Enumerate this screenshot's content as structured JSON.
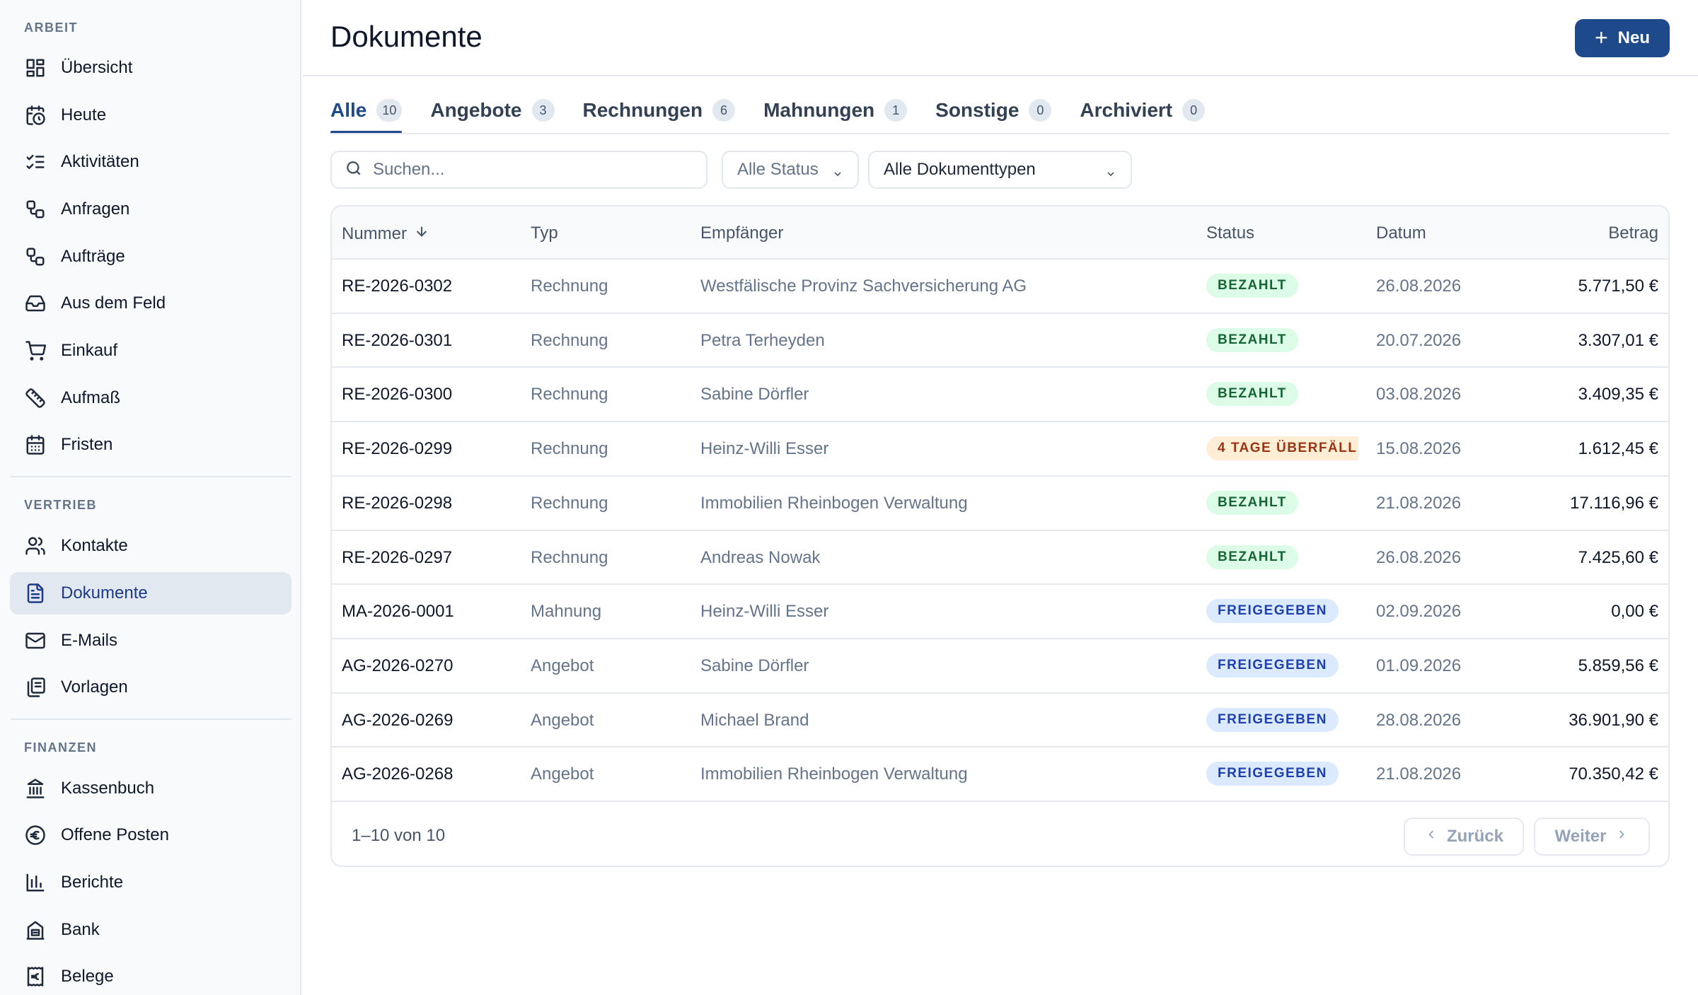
{
  "sidebar": {
    "sections": [
      {
        "title": "ARBEIT",
        "items": [
          {
            "label": "Übersicht",
            "icon": "dashboard-icon"
          },
          {
            "label": "Heute",
            "icon": "calendar-clock-icon"
          },
          {
            "label": "Aktivitäten",
            "icon": "list-checks-icon"
          },
          {
            "label": "Anfragen",
            "icon": "workflow-icon"
          },
          {
            "label": "Aufträge",
            "icon": "workflow-icon"
          },
          {
            "label": "Aus dem Feld",
            "icon": "inbox-icon"
          },
          {
            "label": "Einkauf",
            "icon": "cart-icon"
          },
          {
            "label": "Aufmaß",
            "icon": "ruler-icon"
          },
          {
            "label": "Fristen",
            "icon": "calendar-icon"
          }
        ]
      },
      {
        "title": "VERTRIEB",
        "items": [
          {
            "label": "Kontakte",
            "icon": "users-icon"
          },
          {
            "label": "Dokumente",
            "icon": "document-icon",
            "active": true
          },
          {
            "label": "E-Mails",
            "icon": "mail-icon"
          },
          {
            "label": "Vorlagen",
            "icon": "copy-icon"
          }
        ]
      },
      {
        "title": "FINANZEN",
        "items": [
          {
            "label": "Kassenbuch",
            "icon": "bank-icon"
          },
          {
            "label": "Offene Posten",
            "icon": "euro-circle-icon"
          },
          {
            "label": "Berichte",
            "icon": "bar-chart-icon"
          },
          {
            "label": "Bank",
            "icon": "building-icon"
          },
          {
            "label": "Belege",
            "icon": "receipt-euro-icon"
          }
        ]
      }
    ]
  },
  "header": {
    "title": "Dokumente",
    "new_button": "Neu"
  },
  "tabs": [
    {
      "label": "Alle",
      "count": "10",
      "active": true
    },
    {
      "label": "Angebote",
      "count": "3"
    },
    {
      "label": "Rechnungen",
      "count": "6"
    },
    {
      "label": "Mahnungen",
      "count": "1"
    },
    {
      "label": "Sonstige",
      "count": "0"
    },
    {
      "label": "Archiviert",
      "count": "0"
    }
  ],
  "filters": {
    "search_placeholder": "Suchen...",
    "status_select": "Alle Status",
    "type_select": "Alle Dokumenttypen"
  },
  "table": {
    "columns": {
      "number": "Nummer",
      "type": "Typ",
      "recipient": "Empfänger",
      "status": "Status",
      "date": "Datum",
      "amount": "Betrag"
    },
    "rows": [
      {
        "number": "RE-2026-0302",
        "type": "Rechnung",
        "recipient": "Westfälische Provinz Sachversicherung AG",
        "status": "BEZAHLT",
        "status_kind": "paid",
        "date": "26.08.2026",
        "amount": "5.771,50 €"
      },
      {
        "number": "RE-2026-0301",
        "type": "Rechnung",
        "recipient": "Petra Terheyden",
        "status": "BEZAHLT",
        "status_kind": "paid",
        "date": "20.07.2026",
        "amount": "3.307,01 €"
      },
      {
        "number": "RE-2026-0300",
        "type": "Rechnung",
        "recipient": "Sabine Dörfler",
        "status": "BEZAHLT",
        "status_kind": "paid",
        "date": "03.08.2026",
        "amount": "3.409,35 €"
      },
      {
        "number": "RE-2026-0299",
        "type": "Rechnung",
        "recipient": "Heinz-Willi Esser",
        "status": "4 TAGE ÜBERFÄLL",
        "status_kind": "overdue",
        "date": "15.08.2026",
        "amount": "1.612,45 €"
      },
      {
        "number": "RE-2026-0298",
        "type": "Rechnung",
        "recipient": "Immobilien Rheinbogen Verwaltung",
        "status": "BEZAHLT",
        "status_kind": "paid",
        "date": "21.08.2026",
        "amount": "17.116,96 €"
      },
      {
        "number": "RE-2026-0297",
        "type": "Rechnung",
        "recipient": "Andreas Nowak",
        "status": "BEZAHLT",
        "status_kind": "paid",
        "date": "26.08.2026",
        "amount": "7.425,60 €"
      },
      {
        "number": "MA-2026-0001",
        "type": "Mahnung",
        "recipient": "Heinz-Willi Esser",
        "status": "FREIGEGEBEN",
        "status_kind": "released",
        "date": "02.09.2026",
        "amount": "0,00 €"
      },
      {
        "number": "AG-2026-0270",
        "type": "Angebot",
        "recipient": "Sabine Dörfler",
        "status": "FREIGEGEBEN",
        "status_kind": "released",
        "date": "01.09.2026",
        "amount": "5.859,56 €"
      },
      {
        "number": "AG-2026-0269",
        "type": "Angebot",
        "recipient": "Michael Brand",
        "status": "FREIGEGEBEN",
        "status_kind": "released",
        "date": "28.08.2026",
        "amount": "36.901,90 €"
      },
      {
        "number": "AG-2026-0268",
        "type": "Angebot",
        "recipient": "Immobilien Rheinbogen Verwaltung",
        "status": "FREIGEGEBEN",
        "status_kind": "released",
        "date": "21.08.2026",
        "amount": "70.350,42 €"
      }
    ]
  },
  "pagination": {
    "range": "1–10 von 10",
    "prev": "Zurück",
    "next": "Weiter"
  },
  "colors": {
    "accent": "#1e4a8c",
    "paid_bg": "#dcfce7",
    "released_bg": "#dbeafe",
    "overdue_bg": "#ffedd5"
  }
}
